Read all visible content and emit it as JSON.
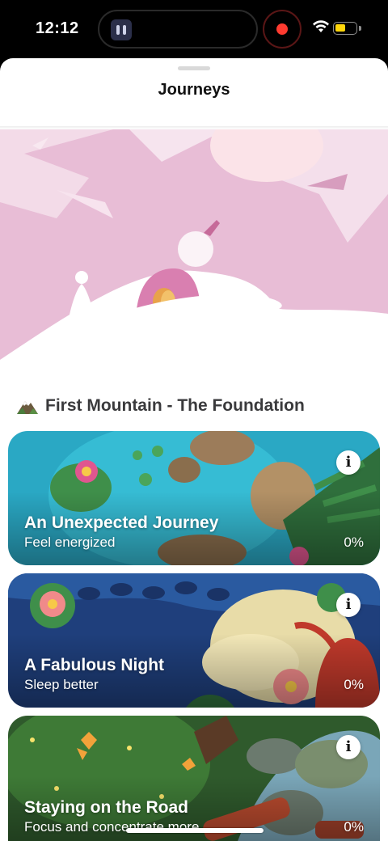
{
  "status_bar": {
    "time": "12:12"
  },
  "sheet": {
    "title": "Journeys"
  },
  "section": {
    "title": "First Mountain - The Foundation",
    "icon": "mountain-icon"
  },
  "journeys": [
    {
      "title": "An Unexpected Journey",
      "subtitle": "Feel energized",
      "progress": "0%",
      "info_icon": "info-icon"
    },
    {
      "title": "A Fabulous Night",
      "subtitle": "Sleep better",
      "progress": "0%",
      "info_icon": "info-icon"
    },
    {
      "title": "Staying on the Road",
      "subtitle": "Focus and concentrate more",
      "progress": "0%",
      "info_icon": "info-icon"
    }
  ],
  "colors": {
    "hero_pink": "#e8b9d4",
    "hero_deep_pink": "#d97fb0",
    "accent_record": "#ff3b30",
    "battery": "#ffd60a"
  }
}
